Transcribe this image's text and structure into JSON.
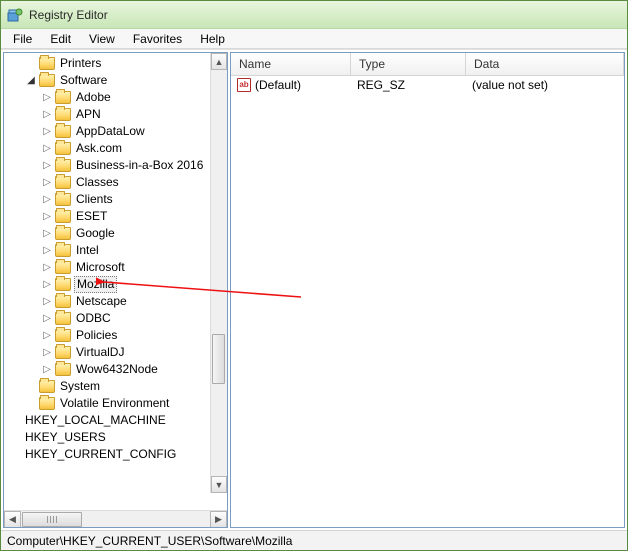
{
  "window_title": "Registry Editor",
  "menus": [
    "File",
    "Edit",
    "View",
    "Favorites",
    "Help"
  ],
  "tree": [
    {
      "indent": 0,
      "expander": "none",
      "label": "Printers"
    },
    {
      "indent": 0,
      "expander": "open",
      "label": "Software"
    },
    {
      "indent": 1,
      "expander": "closed",
      "label": "Adobe"
    },
    {
      "indent": 1,
      "expander": "closed",
      "label": "APN"
    },
    {
      "indent": 1,
      "expander": "closed",
      "label": "AppDataLow"
    },
    {
      "indent": 1,
      "expander": "closed",
      "label": "Ask.com"
    },
    {
      "indent": 1,
      "expander": "closed",
      "label": "Business-in-a-Box 2016"
    },
    {
      "indent": 1,
      "expander": "closed",
      "label": "Classes"
    },
    {
      "indent": 1,
      "expander": "closed",
      "label": "Clients"
    },
    {
      "indent": 1,
      "expander": "closed",
      "label": "ESET"
    },
    {
      "indent": 1,
      "expander": "closed",
      "label": "Google"
    },
    {
      "indent": 1,
      "expander": "closed",
      "label": "Intel"
    },
    {
      "indent": 1,
      "expander": "closed",
      "label": "Microsoft"
    },
    {
      "indent": 1,
      "expander": "closed",
      "label": "Mozilla",
      "selected": true
    },
    {
      "indent": 1,
      "expander": "closed",
      "label": "Netscape"
    },
    {
      "indent": 1,
      "expander": "closed",
      "label": "ODBC"
    },
    {
      "indent": 1,
      "expander": "closed",
      "label": "Policies"
    },
    {
      "indent": 1,
      "expander": "closed",
      "label": "VirtualDJ"
    },
    {
      "indent": 1,
      "expander": "closed",
      "label": "Wow6432Node"
    },
    {
      "indent": 0,
      "expander": "none",
      "label": "System"
    },
    {
      "indent": 0,
      "expander": "none",
      "label": "Volatile Environment"
    },
    {
      "indent": -1,
      "expander": "none",
      "label": "HKEY_LOCAL_MACHINE",
      "no_icon": true
    },
    {
      "indent": -1,
      "expander": "none",
      "label": "HKEY_USERS",
      "no_icon": true
    },
    {
      "indent": -1,
      "expander": "none",
      "label": "HKEY_CURRENT_CONFIG",
      "no_icon": true
    }
  ],
  "columns": {
    "name": "Name",
    "type": "Type",
    "data": "Data"
  },
  "rows": [
    {
      "name": "(Default)",
      "type": "REG_SZ",
      "data": "(value not set)"
    }
  ],
  "status_path": "Computer\\HKEY_CURRENT_USER\\Software\\Mozilla"
}
